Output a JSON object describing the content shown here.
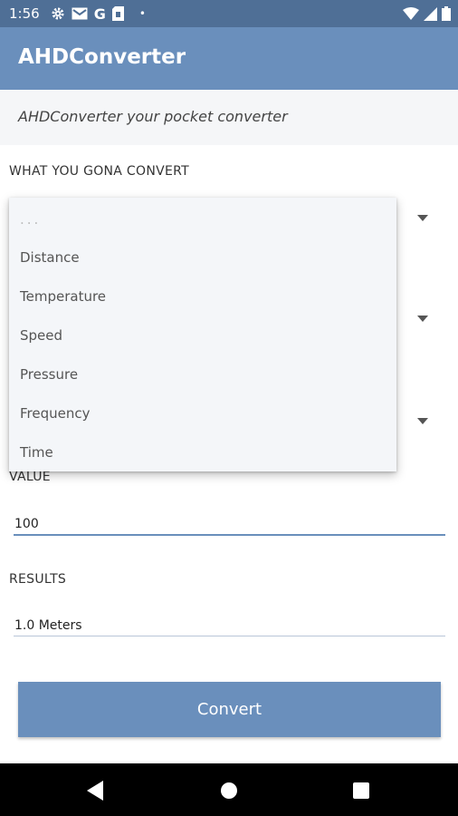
{
  "status_bar": {
    "time": "1:56",
    "icons": [
      "gear-icon",
      "mail-icon",
      "google-icon",
      "sim-icon",
      "dot-icon"
    ],
    "right_icons": [
      "wifi-icon",
      "signal-icon",
      "battery-icon"
    ],
    "google_letter": "G",
    "dot": "•"
  },
  "app_bar": {
    "title": "AHDConverter",
    "color": "#6a8fbc"
  },
  "subtitle": "AHDConverter your pocket converter",
  "convert_section": {
    "label": "WHAT YOU GONA CONVERT"
  },
  "dropdown": {
    "placeholder": "...",
    "options": [
      "Distance",
      "Temperature",
      "Speed",
      "Pressure",
      "Frequency",
      "Time"
    ]
  },
  "value_section": {
    "label": "VALUE",
    "input_value": "100"
  },
  "results_section": {
    "label": "RESULTS",
    "result_value": "1.0 Meters"
  },
  "convert_button": {
    "label": "Convert"
  },
  "nav_bar": {
    "icons": [
      "back-icon",
      "home-icon",
      "recents-icon"
    ]
  }
}
